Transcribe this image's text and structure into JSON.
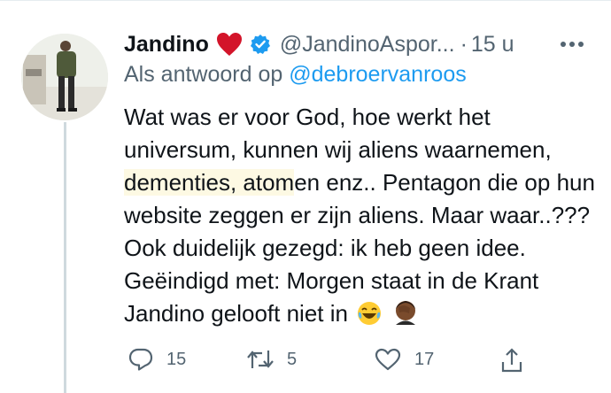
{
  "tweet": {
    "author_name": "Jandino",
    "handle": "@JandinoAspor...",
    "separator": "·",
    "time": "15 u",
    "reply_prefix": "Als antwoord op",
    "reply_mention": "@debroervanroos",
    "text_line1": "Wat was er voor God, hoe werkt het universum, kunnen wij aliens waarnemen, ",
    "text_highlight": "dementies, atom",
    "text_line2": "en enz.. Pentagon die op hun website zeggen er zijn aliens. Maar waar..??? Ook duidelijk gezegd: ik heb geen idee. Geëindigd met: Morgen staat in de Krant Jandino gelooft niet in"
  },
  "actions": {
    "reply_count": "15",
    "retweet_count": "5",
    "like_count": "17"
  },
  "icons": [
    "heart-emoji-icon",
    "verified-badge-icon",
    "more-icon",
    "laughing-emoji-icon",
    "facepalm-emoji-icon",
    "reply-icon",
    "retweet-icon",
    "like-icon",
    "share-icon"
  ],
  "colors": {
    "accent": "#1d9bf0",
    "secondary_text": "#536471",
    "heart": "#d3142a"
  }
}
